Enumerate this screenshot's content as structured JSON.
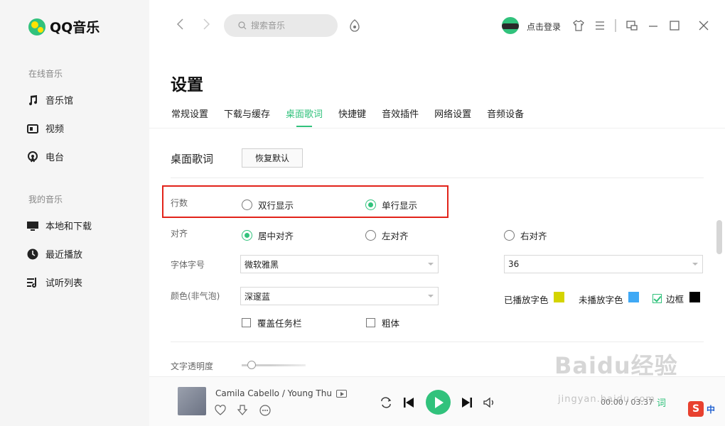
{
  "app": {
    "name": "QQ音乐"
  },
  "sidebar": {
    "section_online": "在线音乐",
    "online_items": [
      {
        "label": "音乐馆",
        "icon": "music-note-icon"
      },
      {
        "label": "视频",
        "icon": "video-icon"
      },
      {
        "label": "电台",
        "icon": "radio-icon"
      }
    ],
    "section_mine": "我的音乐",
    "my_items": [
      {
        "label": "本地和下载",
        "icon": "monitor-icon"
      },
      {
        "label": "最近播放",
        "icon": "clock-icon"
      },
      {
        "label": "试听列表",
        "icon": "playlist-icon"
      }
    ]
  },
  "topbar": {
    "search_placeholder": "搜索音乐",
    "login_label": "点击登录"
  },
  "settings": {
    "title": "设置",
    "tabs": [
      "常规设置",
      "下载与缓存",
      "桌面歌词",
      "快捷键",
      "音效插件",
      "网络设置",
      "音频设备"
    ],
    "active_tab": "桌面歌词",
    "section_title": "桌面歌词",
    "restore_label": "恢复默认",
    "lines": {
      "label": "行数",
      "double": "双行显示",
      "single": "单行显示",
      "selected": "单行显示"
    },
    "align": {
      "label": "对齐",
      "center": "居中对齐",
      "left": "左对齐",
      "right": "右对齐",
      "selected": "居中对齐"
    },
    "font": {
      "label": "字体字号",
      "family": "微软雅黑",
      "size": "36"
    },
    "color": {
      "label": "颜色(非气泡)",
      "theme": "深邃蓝",
      "played_label": "已播放字色",
      "played_color": "#d4d400",
      "unplayed_label": "未播放字色",
      "unplayed_color": "#3fa9f5",
      "border_label": "边框",
      "border_color": "#000000",
      "border_checked": true
    },
    "cover_taskbar": "覆盖任务栏",
    "bold": "粗体",
    "opacity_label": "文字透明度",
    "opacity_value": 0.15
  },
  "player": {
    "song": "Camila Cabello / Young Thu",
    "time": "00:00 / 03:37",
    "lyric_btn": "词"
  },
  "watermark": {
    "text": "Baidu经验",
    "sub": "jingyan.baidu.com"
  },
  "ime": {
    "s": "S",
    "mode": "中"
  },
  "accent": "#31c27c"
}
